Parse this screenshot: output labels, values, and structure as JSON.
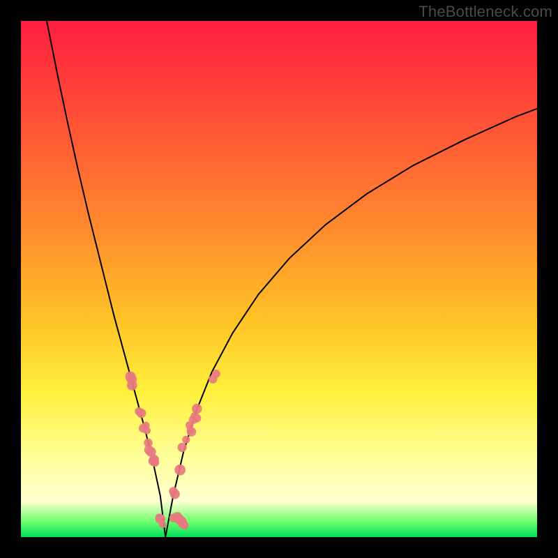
{
  "watermark": "TheBottleneck.com",
  "chart_data": {
    "type": "line",
    "title": "",
    "xlabel": "",
    "ylabel": "",
    "xlim": [
      0,
      100
    ],
    "ylim": [
      0,
      100
    ],
    "series": [
      {
        "name": "left-curve",
        "x": [
          5,
          7,
          9,
          11,
          13,
          15,
          16.5,
          18,
          19.5,
          21,
          22.5,
          24,
          25.5,
          27,
          28
        ],
        "values": [
          100,
          90,
          80.5,
          71.5,
          63,
          55,
          49,
          43,
          37.5,
          32,
          26.5,
          21,
          15,
          8,
          0
        ]
      },
      {
        "name": "right-curve",
        "x": [
          28,
          29.5,
          31.5,
          34,
          37,
          41,
          46,
          52,
          59,
          67,
          76,
          86,
          96,
          100
        ],
        "values": [
          0,
          8,
          16.5,
          24.5,
          32,
          39.5,
          47,
          54,
          60.5,
          66.5,
          72,
          77,
          81.5,
          83
        ]
      }
    ],
    "markers": [
      {
        "name": "left-cluster",
        "x_range": [
          21,
          27.5
        ],
        "y_range": [
          6,
          34
        ],
        "count": 14
      },
      {
        "name": "bottom-cluster",
        "x_range": [
          26,
          32
        ],
        "y_range": [
          0,
          4
        ],
        "count": 10
      },
      {
        "name": "right-cluster-low",
        "x_range": [
          29.5,
          34.5
        ],
        "y_range": [
          6,
          26
        ],
        "count": 12
      },
      {
        "name": "right-outlier",
        "x_range": [
          36,
          38
        ],
        "y_range": [
          30,
          33
        ],
        "count": 2
      }
    ],
    "marker_color": "#e77a7f",
    "curve_color": "#000000",
    "background": {
      "type": "vertical-gradient",
      "stops": [
        {
          "pos": 0.0,
          "color": "#ff1f3f"
        },
        {
          "pos": 0.4,
          "color": "#ff8a2e"
        },
        {
          "pos": 0.72,
          "color": "#fff03d"
        },
        {
          "pos": 0.93,
          "color": "#ffffd0"
        },
        {
          "pos": 1.0,
          "color": "#00e05a"
        }
      ]
    }
  }
}
